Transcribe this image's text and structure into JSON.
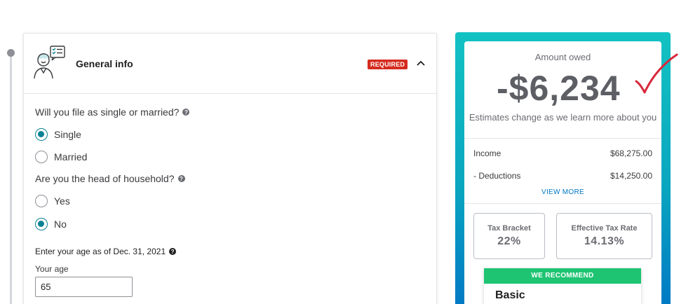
{
  "general_info": {
    "title": "General info",
    "required_badge": "REQUIRED",
    "filing_question": "Will you file as single or married?",
    "filing_options": [
      {
        "label": "Single",
        "selected": true
      },
      {
        "label": "Married",
        "selected": false
      }
    ],
    "hoh_question": "Are you the head of household?",
    "hoh_options": [
      {
        "label": "Yes",
        "selected": false
      },
      {
        "label": "No",
        "selected": true
      }
    ],
    "age_prompt": "Enter your age as of Dec. 31, 2021",
    "age_label": "Your age",
    "age_value": "65"
  },
  "summary": {
    "amount_label": "Amount owed",
    "amount": "-$6,234",
    "note": "Estimates change as we learn more about you",
    "income_label": "Income",
    "income_value": "$68,275.00",
    "deductions_label": "- Deductions",
    "deductions_value": "$14,250.00",
    "view_more": "VIEW MORE",
    "tax_bracket_label": "Tax Bracket",
    "tax_bracket_value": "22%",
    "effective_rate_label": "Effective Tax Rate",
    "effective_rate_value": "14.13%",
    "recommend_banner": "WE RECOMMEND",
    "recommend_plan": "Basic"
  },
  "colors": {
    "accent_teal": "#0a8293",
    "required_red": "#d52b1e",
    "recommend_green": "#1ec472",
    "link_blue": "#0077c5",
    "checkmark_red": "#d6283a"
  },
  "icons": [
    "person-chat-icon",
    "chevron-up-icon",
    "help-icon",
    "checkmark-icon"
  ]
}
